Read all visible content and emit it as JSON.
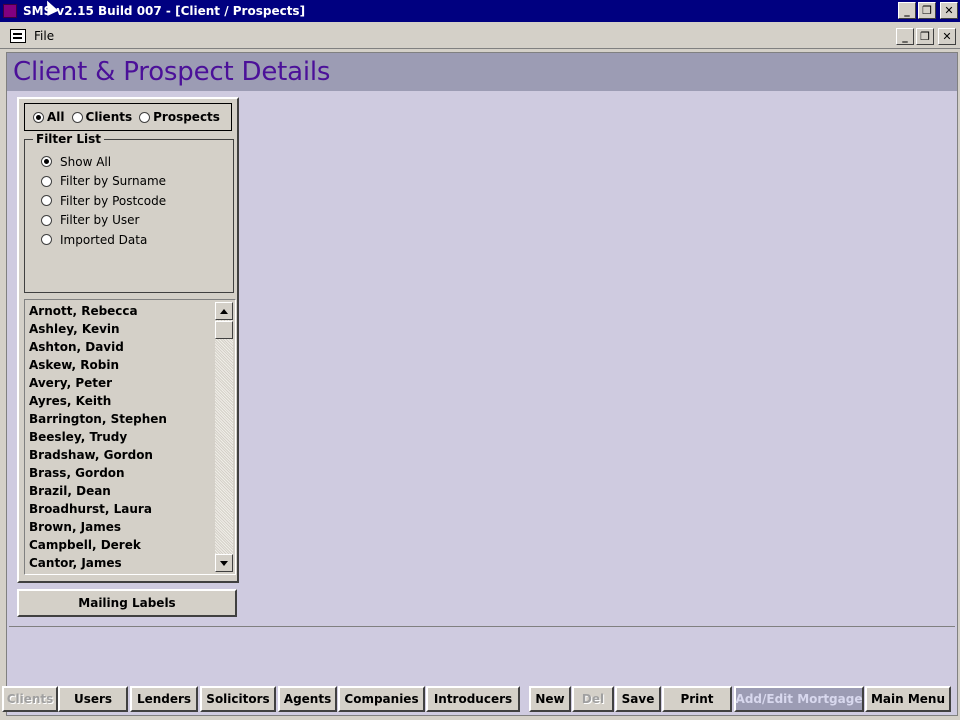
{
  "window": {
    "title": "SMS v2.15 Build 007 - [Client / Prospects]",
    "minimize": "_",
    "restore": "❐",
    "close": "✕"
  },
  "menu": {
    "file": "File"
  },
  "page": {
    "title": "Client & Prospect Details"
  },
  "type_filter": {
    "options": [
      "All",
      "Clients",
      "Prospects"
    ],
    "selected": "All"
  },
  "filter_list": {
    "legend": "Filter List",
    "options": [
      "Show All",
      "Filter by Surname",
      "Filter by Postcode",
      "Filter by User",
      "Imported Data"
    ],
    "selected": "Show All"
  },
  "names": [
    "Arnott, Rebecca",
    "Ashley, Kevin",
    "Ashton, David",
    "Askew, Robin",
    "Avery, Peter",
    "Ayres, Keith",
    "Barrington, Stephen",
    "Beesley, Trudy",
    "Bradshaw, Gordon",
    "Brass, Gordon",
    "Brazil, Dean",
    "Broadhurst, Laura",
    "Brown, James",
    "Campbell, Derek",
    "Cantor, James"
  ],
  "mailing_labels": "Mailing Labels",
  "nav_buttons": {
    "clients": "Clients",
    "users": "Users",
    "lenders": "Lenders",
    "solicitors": "Solicitors",
    "agents": "Agents",
    "companies": "Companies",
    "introducers": "Introducers"
  },
  "action_buttons": {
    "new": "New",
    "del": "Del",
    "save": "Save",
    "print": "Print",
    "add_edit_mortgage": "Add/Edit Mortgage",
    "main_menu": "Main Menu"
  },
  "colors": {
    "title_bar": "#000080",
    "header_band": "#9c9cb4",
    "header_text": "#4b1099",
    "content_bg": "#cfcbe0"
  }
}
